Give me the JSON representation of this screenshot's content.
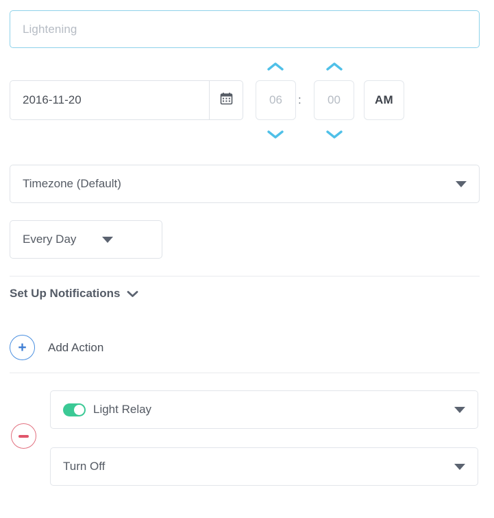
{
  "name_field": {
    "placeholder": "Lightening",
    "value": ""
  },
  "schedule": {
    "date_value": "2016-11-20",
    "calendar_icon": "calendar-icon",
    "hour_value": "06",
    "hour_placeholder": "06",
    "separator": ":",
    "minute_value": "00",
    "minute_placeholder": "00",
    "meridiem_value": "AM",
    "hour_up_icon": "chevron-up-icon",
    "hour_down_icon": "chevron-down-icon",
    "minute_up_icon": "chevron-up-icon",
    "minute_down_icon": "chevron-down-icon"
  },
  "timezone": {
    "selected": "Timezone (Default)",
    "caret_icon": "caret-down-icon"
  },
  "repeat": {
    "selected": "Every Day",
    "caret_icon": "caret-down-icon"
  },
  "notifications": {
    "label": "Set Up Notifications",
    "chevron_icon": "chevron-down-icon"
  },
  "add_action": {
    "label": "Add Action",
    "plus_icon": "+"
  },
  "actions": [
    {
      "remove_icon": "minus-icon",
      "device": "Light Relay",
      "device_toggle_on": true,
      "device_caret_icon": "caret-down-icon",
      "command": "Turn Off",
      "command_caret_icon": "caret-down-icon"
    }
  ],
  "colors": {
    "focus_border": "#8ed2ea",
    "chevron_blue": "#4fc0e8",
    "add_blue": "#3f7fd4",
    "remove_red": "#e0566b",
    "toggle_green": "#3bc995",
    "text_dark": "#545b66",
    "text_muted": "#b6bcc4",
    "border": "#dfe3e8"
  }
}
